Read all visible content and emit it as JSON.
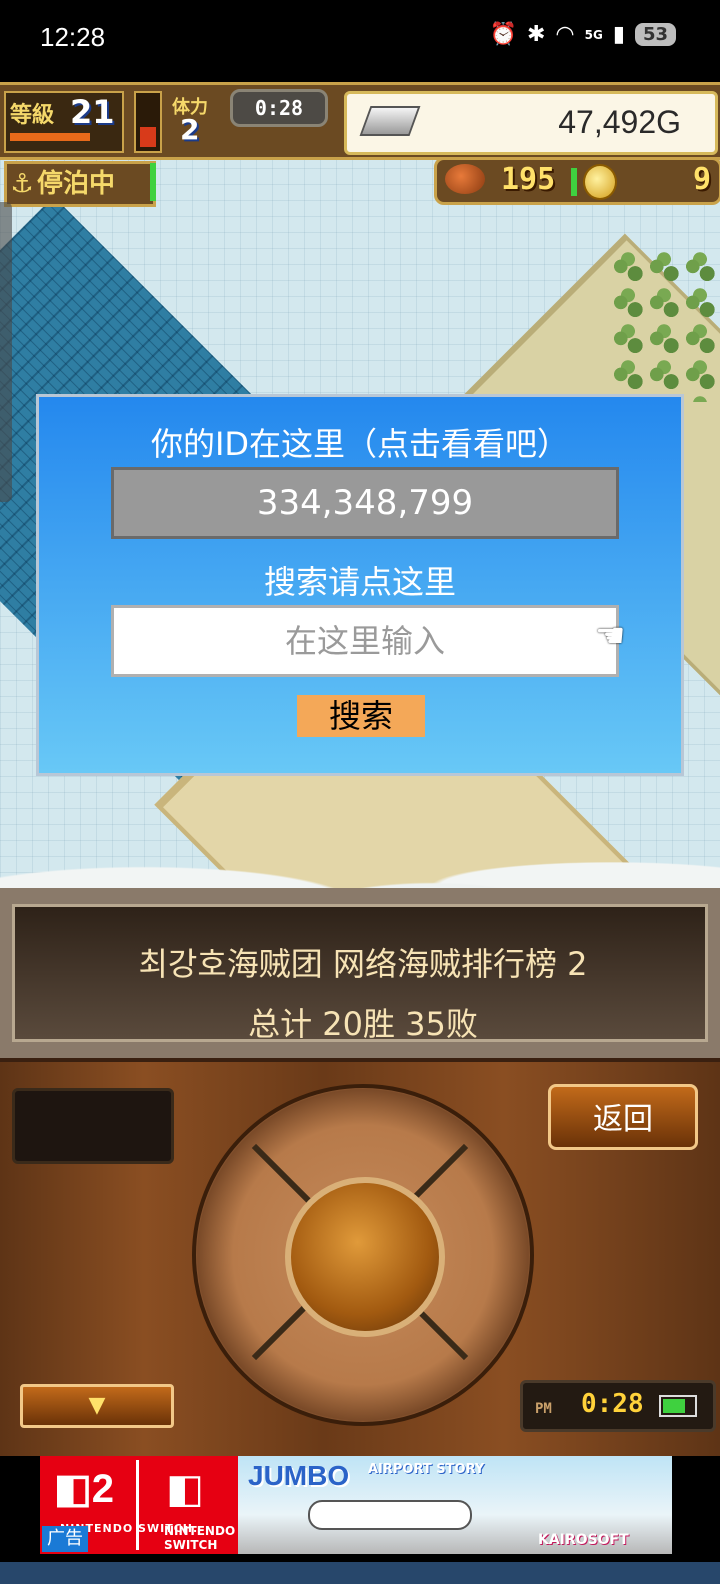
{
  "status_bar": {
    "time": "12:28",
    "network": "5G",
    "battery": "53"
  },
  "hud": {
    "level_label": "等級",
    "level_value": "21",
    "stamina_label": "体力",
    "stamina_value": "2",
    "timer": "0:28",
    "gold": "47,492G",
    "dock_status": "停泊中",
    "food": "195",
    "coins": "9"
  },
  "dialog": {
    "title": "你的ID在这里（点击看看吧）",
    "player_id": "334,348,799",
    "search_prompt": "搜索请点这里",
    "search_placeholder": "在这里输入",
    "search_button": "搜索"
  },
  "ranking": {
    "line1": "최강호海贼团  网络海贼排行榜  2",
    "line2": "总计 20胜 35败"
  },
  "controls": {
    "back_button": "返回",
    "clock_ampm": "PM",
    "clock_time": "0:28"
  },
  "ad": {
    "label": "广告",
    "switch_logo": "2",
    "switch_text": "NINTENDO SWITCH.",
    "switch_text2": "NINTENDO SWITCH",
    "game_title": "JUMBO",
    "game_subtitle": "AIRPORT STORY",
    "brand": "KAIROSOFT"
  },
  "colors": {
    "dialog_top": "#2488ee",
    "dialog_bottom": "#68c8f6",
    "search_button": "#f4a858",
    "switch_red": "#e60012"
  }
}
